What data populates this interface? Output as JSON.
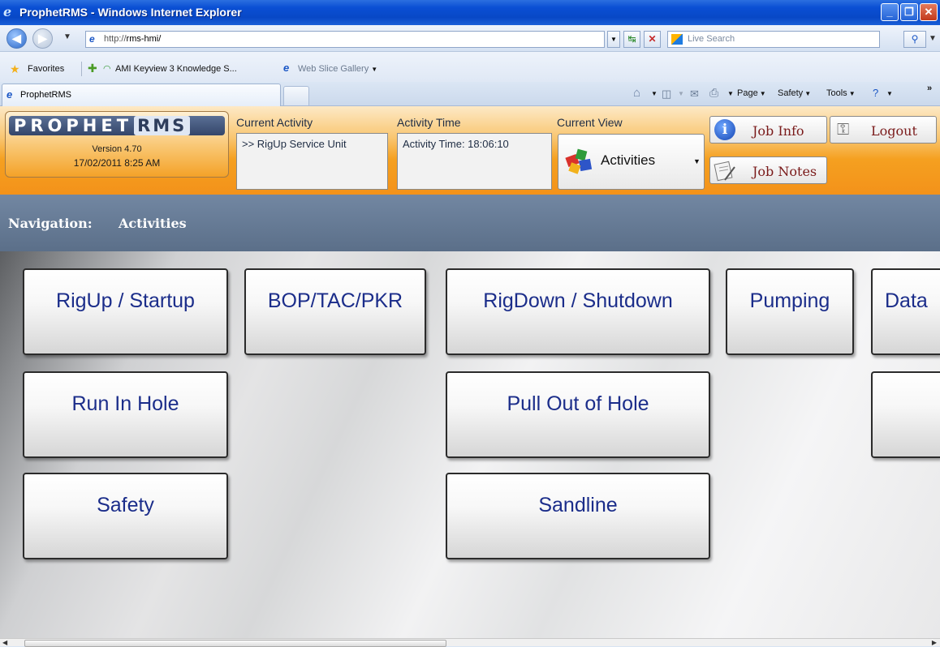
{
  "window": {
    "title": "ProphetRMS - Windows Internet Explorer",
    "minimize": "_",
    "maximize": "❐",
    "close": "✕"
  },
  "address": {
    "url_prefix": "http://",
    "url_host": "rms-hmi/",
    "search_placeholder": "Live Search"
  },
  "favorites": {
    "label": "Favorites",
    "items": [
      "AMI Keyview 3 Knowledge S...",
      "Web Slice Gallery"
    ]
  },
  "tabs": {
    "active": "ProphetRMS"
  },
  "commandbar": {
    "page": "Page",
    "safety": "Safety",
    "tools": "Tools"
  },
  "header": {
    "brand_main": "PROPHET",
    "brand_rms": "RMS",
    "version": "Version 4.70",
    "datetime": "17/02/2011 8:25 AM",
    "current_activity_label": "Current Activity",
    "current_activity_value": ">> RigUp Service Unit",
    "activity_time_label": "Activity Time",
    "activity_time_value": "Activity Time: 18:06:10",
    "current_view_label": "Current View",
    "current_view_value": "Activities",
    "job_info": "Job Info",
    "logout": "Logout",
    "job_notes": "Job Notes"
  },
  "navigation": {
    "label": "Navigation:",
    "value": "Activities"
  },
  "activities": {
    "rigup": "RigUp / Startup",
    "bop": "BOP/TAC/PKR",
    "rigdown": "RigDown / Shutdown",
    "pumping": "Pumping",
    "data": "Data",
    "run_in_hole": "Run In Hole",
    "pull_out": "Pull Out of Hole",
    "safety": "Safety",
    "sandline": "Sandline"
  },
  "colors": {
    "accent_orange": "#f3921a",
    "nav_blue": "#5b6f89",
    "button_text": "#1b2d8a"
  }
}
